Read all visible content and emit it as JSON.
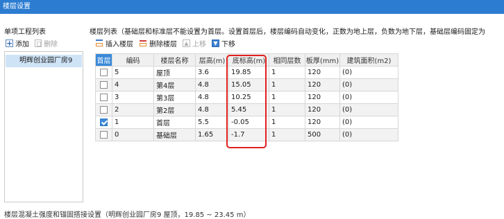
{
  "window": {
    "title": "楼层设置"
  },
  "left_panel": {
    "title": "单项工程列表",
    "toolbar": {
      "add_label": "添加",
      "delete_label": "删除"
    },
    "projects": [
      "明辉创业园厂房9"
    ]
  },
  "right_panel": {
    "title": "楼层列表（基础层和标准层不能设置为首层。设置首层后，楼层编码自动变化，正数为地上层，负数为地下层，基础层编码固定为",
    "toolbar": {
      "insert_label": "插入楼层",
      "remove_label": "删除楼层",
      "up_label": "上移",
      "down_label": "下移"
    },
    "table": {
      "headers": {
        "first_floor": "首层",
        "code": "编码",
        "name": "楼层名称",
        "height": "层高(m)",
        "bottom_elev": "底标高(m)",
        "same_count": "相同层数",
        "slab": "板厚(mm)",
        "area": "建筑面积(m2)"
      },
      "rows": [
        {
          "code": "5",
          "name": "屋顶",
          "height": "3.6",
          "bottom_elev": "19.85",
          "same_count": "1",
          "slab": "120",
          "area": "(0)"
        },
        {
          "code": "4",
          "name": "第4层",
          "height": "4.8",
          "bottom_elev": "15.05",
          "same_count": "1",
          "slab": "120",
          "area": "(0)"
        },
        {
          "code": "3",
          "name": "第3层",
          "height": "4.8",
          "bottom_elev": "10.25",
          "same_count": "1",
          "slab": "120",
          "area": "(0)"
        },
        {
          "code": "2",
          "name": "第2层",
          "height": "4.8",
          "bottom_elev": "5.45",
          "same_count": "1",
          "slab": "120",
          "area": "(0)"
        },
        {
          "code": "1",
          "name": "首层",
          "height": "5.5",
          "bottom_elev": "-0.05",
          "same_count": "1",
          "slab": "120",
          "area": "(0)"
        },
        {
          "code": "0",
          "name": "基础层",
          "height": "1.65",
          "bottom_elev": "-1.7",
          "same_count": "1",
          "slab": "500",
          "area": "(0)"
        }
      ]
    }
  },
  "bottom": {
    "text": "楼层混凝土强度和锚固搭接设置（明辉创业园厂房9 屋顶，19.85 ~ 23.45 m）"
  },
  "colors": {
    "title_bar": "#2c7cd1",
    "selection": "#cfe3f7",
    "highlight_box": "#e0201c"
  }
}
